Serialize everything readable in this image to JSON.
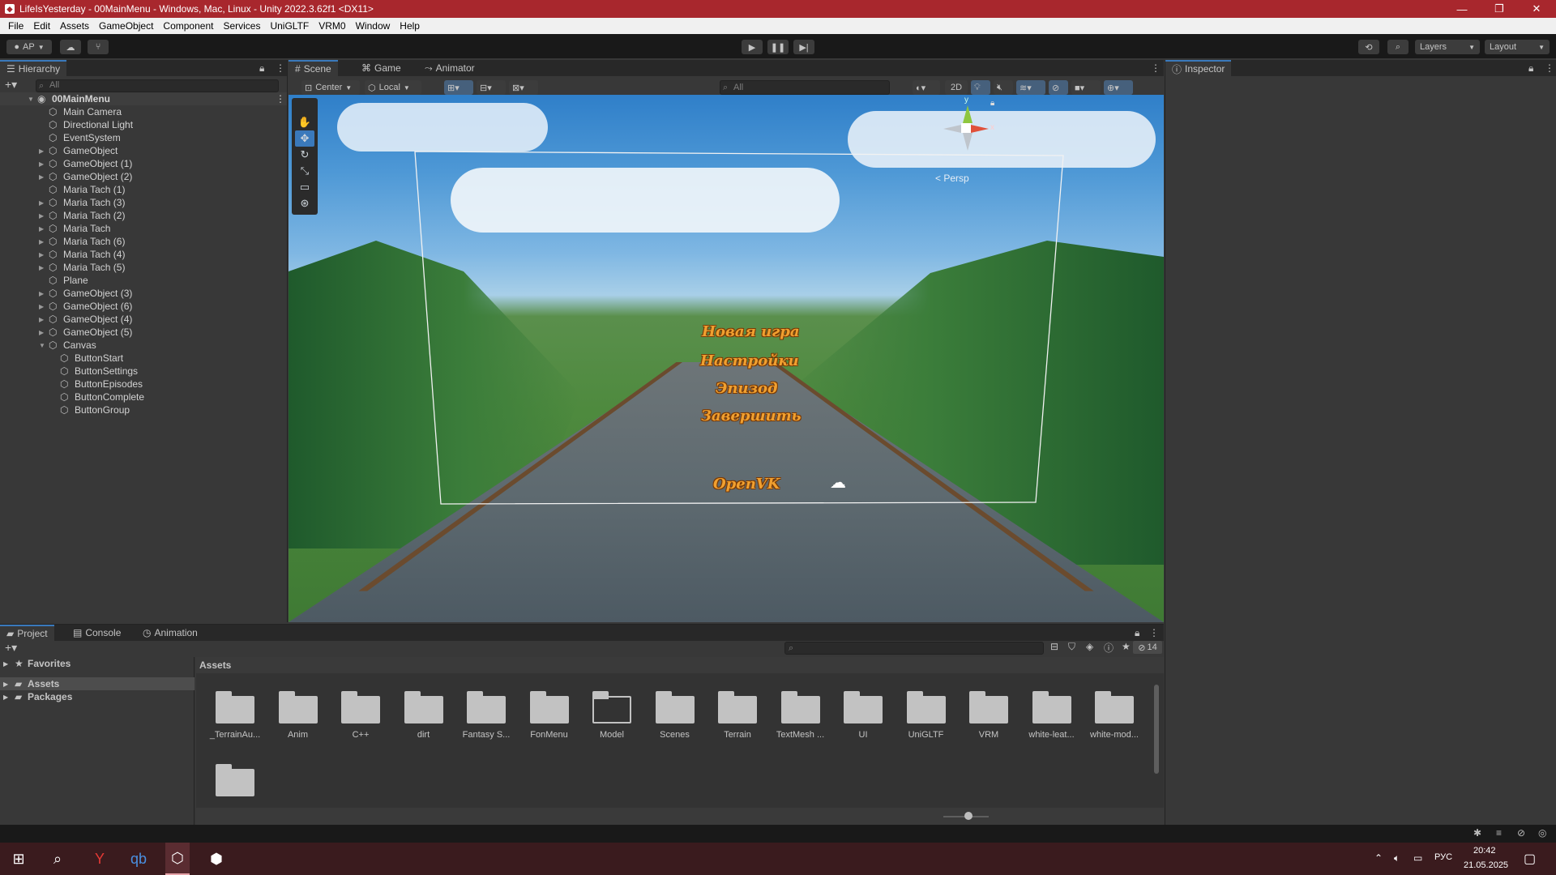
{
  "window": {
    "title": "LifeIsYesterday - 00MainMenu - Windows, Mac, Linux - Unity 2022.3.62f1 <DX11>",
    "minimize": "—",
    "restore": "❐",
    "close": "✕"
  },
  "menu": [
    "File",
    "Edit",
    "Assets",
    "GameObject",
    "Component",
    "Services",
    "UniGLTF",
    "VRM0",
    "Window",
    "Help"
  ],
  "toolbar": {
    "account": "AP",
    "layers": "Layers",
    "layout": "Layout"
  },
  "hierarchy": {
    "tab": "Hierarchy",
    "search_placeholder": "All",
    "scene": "00MainMenu",
    "items": [
      {
        "label": "Main Camera",
        "expandable": false
      },
      {
        "label": "Directional Light",
        "expandable": false
      },
      {
        "label": "EventSystem",
        "expandable": false
      },
      {
        "label": "GameObject",
        "expandable": true
      },
      {
        "label": "GameObject (1)",
        "expandable": true
      },
      {
        "label": "GameObject (2)",
        "expandable": true
      },
      {
        "label": "Maria Tach (1)",
        "expandable": false
      },
      {
        "label": "Maria Tach (3)",
        "expandable": true
      },
      {
        "label": "Maria Tach (2)",
        "expandable": true
      },
      {
        "label": "Maria Tach",
        "expandable": true
      },
      {
        "label": "Maria Tach (6)",
        "expandable": true
      },
      {
        "label": "Maria Tach (4)",
        "expandable": true
      },
      {
        "label": "Maria Tach (5)",
        "expandable": true
      },
      {
        "label": "Plane",
        "expandable": false
      },
      {
        "label": "GameObject (3)",
        "expandable": true
      },
      {
        "label": "GameObject (6)",
        "expandable": true
      },
      {
        "label": "GameObject (4)",
        "expandable": true
      },
      {
        "label": "GameObject (5)",
        "expandable": true
      },
      {
        "label": "Canvas",
        "expandable": true,
        "expanded": true
      }
    ],
    "canvas_children": [
      "ButtonStart",
      "ButtonSettings",
      "ButtonEpisodes",
      "ButtonComplete",
      "ButtonGroup"
    ]
  },
  "scene": {
    "tabs": [
      "Scene",
      "Game",
      "Animator"
    ],
    "pivot": "Center",
    "space": "Local",
    "search_placeholder": "All",
    "mode_2d": "2D",
    "gizmo_label": "< Persp",
    "gizmo_y": "y",
    "gizmo_x": "x",
    "menu_items": [
      "Новая игра",
      "Настройки",
      "Эпизод",
      "Завершить",
      "OpenVK"
    ]
  },
  "inspector": {
    "tab": "Inspector"
  },
  "project": {
    "tabs": [
      "Project",
      "Console",
      "Animation"
    ],
    "favorites": "Favorites",
    "assets": "Assets",
    "packages": "Packages",
    "breadcrumb": "Assets",
    "hidden_count": "14",
    "folders": [
      "_TerrainAu...",
      "Anim",
      "C++",
      "dirt",
      "Fantasy S...",
      "FonMenu",
      "Model",
      "Scenes",
      "Terrain",
      "TextMesh ...",
      "UI",
      "UniGLTF",
      "VRM",
      "white-leat...",
      "white-mod..."
    ],
    "open_folder": "Model"
  },
  "taskbar": {
    "language": "РУС",
    "time": "20:42",
    "date": "21.05.2025"
  },
  "colors": {
    "titlebar": "#a8272d",
    "accent": "#3a79bb",
    "menu_text": "#f0a030"
  }
}
